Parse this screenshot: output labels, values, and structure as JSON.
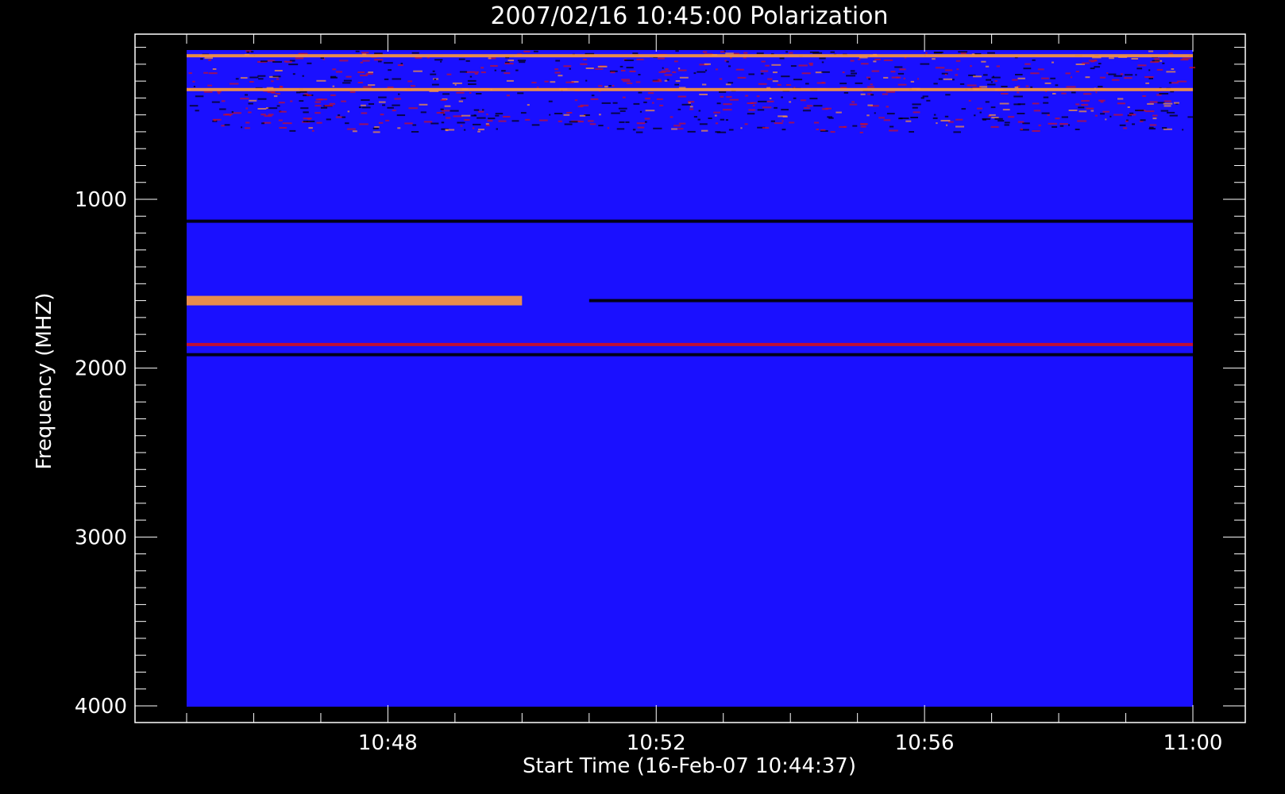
{
  "chart_data": {
    "type": "heatmap",
    "title": "2007/02/16 10:45:00 Polarization",
    "xlabel": "Start Time (16-Feb-07 10:44:37)",
    "ylabel": "Frequency (MHZ)",
    "x_axis": {
      "unit": "time",
      "range": [
        "10:45:00",
        "11:00:00"
      ],
      "ticks": [
        "10:48",
        "10:52",
        "10:56",
        "11:00"
      ]
    },
    "y_axis": {
      "unit": "MHz",
      "range": [
        100,
        4000
      ],
      "inverted": true,
      "ticks": [
        1000,
        2000,
        3000,
        4000
      ]
    },
    "colors": {
      "background": "#000000",
      "axes": "#ffffff",
      "base": "#1a10ff",
      "weak": "#d01020",
      "strong": "#ff9a3a",
      "negative": "#000000"
    },
    "features": [
      {
        "kind": "noisy-band",
        "freq_from": 100,
        "freq_to": 600
      },
      {
        "kind": "line",
        "freq": 150,
        "color": "strong"
      },
      {
        "kind": "line",
        "freq": 350,
        "color": "strong"
      },
      {
        "kind": "line",
        "freq": 1130,
        "color": "negative"
      },
      {
        "kind": "line",
        "freq": 1600,
        "color": "strong",
        "from": "10:45:00",
        "to": "10:50:00"
      },
      {
        "kind": "line",
        "freq": 1600,
        "color": "negative",
        "from": "10:51:00",
        "to": "11:00:00"
      },
      {
        "kind": "line",
        "freq": 1920,
        "color": "negative"
      },
      {
        "kind": "line",
        "freq": 1860,
        "color": "weak"
      }
    ]
  }
}
